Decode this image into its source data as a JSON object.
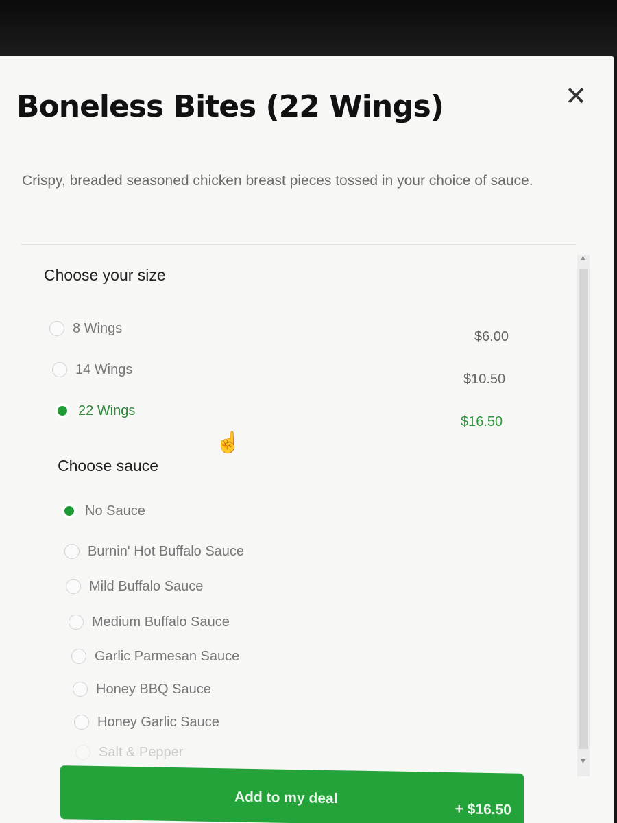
{
  "modal": {
    "title": "Boneless Bites (22 Wings)",
    "close_icon": "close-icon",
    "description": "Crispy, breaded seasoned chicken breast pieces tossed in your choice of sauce."
  },
  "size_section": {
    "title": "Choose your size",
    "options": [
      {
        "label": "8 Wings",
        "price": "$6.00",
        "selected": false
      },
      {
        "label": "14 Wings",
        "price": "$10.50",
        "selected": false
      },
      {
        "label": "22 Wings",
        "price": "$16.50",
        "selected": true
      }
    ]
  },
  "sauce_section": {
    "title": "Choose sauce",
    "options": [
      {
        "label": "No Sauce",
        "selected": true
      },
      {
        "label": "Burnin' Hot Buffalo Sauce",
        "selected": false
      },
      {
        "label": "Mild Buffalo Sauce",
        "selected": false
      },
      {
        "label": "Medium Buffalo Sauce",
        "selected": false
      },
      {
        "label": "Garlic Parmesan Sauce",
        "selected": false
      },
      {
        "label": "Honey BBQ Sauce",
        "selected": false
      },
      {
        "label": "Honey Garlic Sauce",
        "selected": false
      },
      {
        "label": "Salt & Pepper",
        "selected": false
      }
    ]
  },
  "footer": {
    "button_label": "Add to my deal",
    "button_price": "+ $16.50"
  },
  "colors": {
    "accent_green": "#23a33a",
    "selected_text": "#2a9a3d"
  }
}
